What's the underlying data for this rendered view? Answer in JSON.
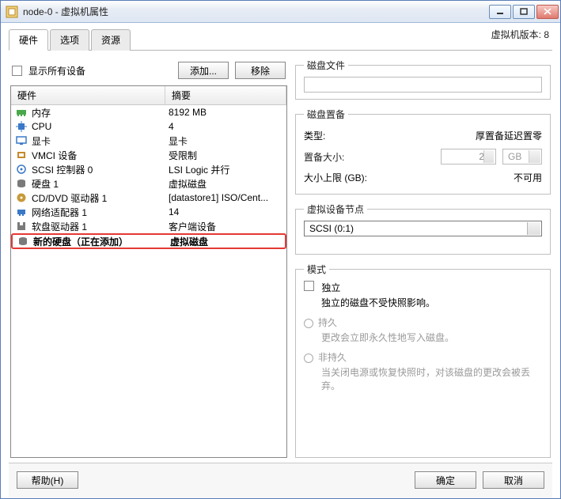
{
  "window": {
    "title": "node-0 - 虚拟机属性"
  },
  "winControls": {
    "min": "—",
    "max": "□",
    "close": "×"
  },
  "versionLabel": "虚拟机版本: 8",
  "tabs": [
    "硬件",
    "选项",
    "资源"
  ],
  "activeTab": 0,
  "toolbar": {
    "showAllLabel": "显示所有设备",
    "addLabel": "添加...",
    "removeLabel": "移除"
  },
  "headers": {
    "hardware": "硬件",
    "summary": "摘要"
  },
  "devices": [
    {
      "icon": "memory",
      "name": "内存",
      "summary": "8192 MB"
    },
    {
      "icon": "cpu",
      "name": "CPU",
      "summary": "4"
    },
    {
      "icon": "video",
      "name": "显卡",
      "summary": "显卡"
    },
    {
      "icon": "vmci",
      "name": "VMCI 设备",
      "summary": "受限制"
    },
    {
      "icon": "scsi",
      "name": "SCSI 控制器 0",
      "summary": "LSI Logic 并行"
    },
    {
      "icon": "disk",
      "name": "硬盘 1",
      "summary": "虚拟磁盘"
    },
    {
      "icon": "cd",
      "name": "CD/DVD 驱动器 1",
      "summary": "[datastore1] ISO/Cent..."
    },
    {
      "icon": "nic",
      "name": "网络适配器 1",
      "summary": "14"
    },
    {
      "icon": "floppy",
      "name": "软盘驱动器 1",
      "summary": "客户端设备"
    },
    {
      "icon": "disk",
      "name": "新的硬盘（正在添加）",
      "summary": "虚拟磁盘",
      "highlight": true
    }
  ],
  "groups": {
    "diskFile": {
      "legend": "磁盘文件",
      "value": ""
    },
    "diskProvision": {
      "legend": "磁盘置备",
      "typeLabel": "类型:",
      "typeValue": "厚置备延迟置零",
      "sizeLabel": "置备大小:",
      "sizeValue": "2",
      "sizeUnit": "GB",
      "maxLabel": "大小上限 (GB):",
      "maxValue": "不可用"
    },
    "virtualNode": {
      "legend": "虚拟设备节点",
      "value": "SCSI (0:1)"
    },
    "mode": {
      "legend": "模式",
      "independentLabel": "独立",
      "independentDesc": "独立的磁盘不受快照影响。",
      "persistentLabel": "持久",
      "persistentDesc": "更改会立即永久性地写入磁盘。",
      "nonpersistentLabel": "非持久",
      "nonpersistentDesc": "当关闭电源或恢复快照时，对该磁盘的更改会被丢弃。"
    }
  },
  "footer": {
    "help": "帮助(H)",
    "ok": "确定",
    "cancel": "取消"
  },
  "iconColors": {
    "memory": "#4aa84a",
    "cpu": "#3a78c8",
    "video": "#3a78c8",
    "vmci": "#c78a2a",
    "scsi": "#3a78c8",
    "disk": "#7a7a7a",
    "cd": "#c79a3a",
    "nic": "#3a78c8",
    "floppy": "#7a7a7a"
  }
}
